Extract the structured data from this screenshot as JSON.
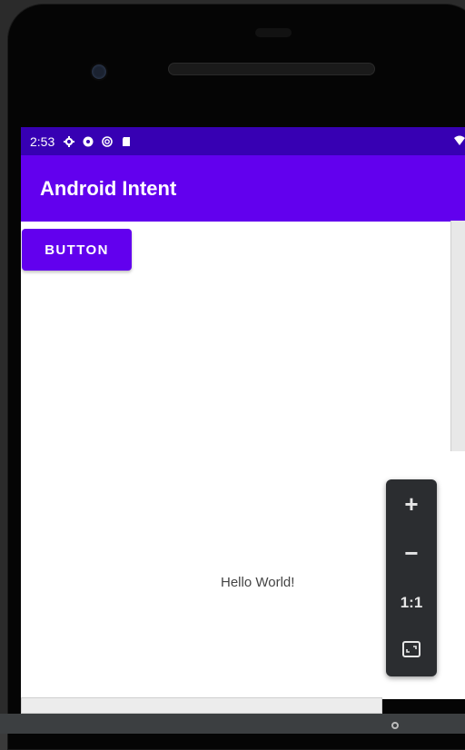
{
  "status_bar": {
    "time": "2:53",
    "icons": [
      "settings-icon",
      "shield-icon",
      "sync-icon",
      "sd-card-icon",
      "wifi-icon"
    ]
  },
  "app_bar": {
    "title": "Android Intent"
  },
  "main": {
    "button_label": "BUTTON",
    "hello_text": "Hello World!"
  },
  "zoom_controls": {
    "zoom_in": "+",
    "zoom_out": "−",
    "actual_size": "1:1",
    "fit_screen_icon": "fit-screen-icon"
  },
  "colors": {
    "status_bar": "#3700b3",
    "primary": "#6200ee",
    "zoom_panel": "#2b2d30"
  }
}
